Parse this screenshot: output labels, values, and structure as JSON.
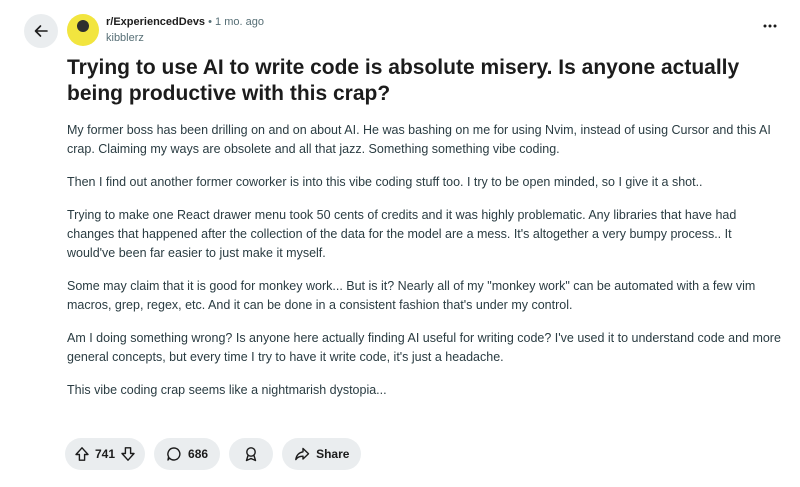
{
  "post": {
    "subreddit": "r/ExperiencedDevs",
    "separator": "•",
    "time": "1 mo. ago",
    "author": "kibblerz",
    "title": "Trying to use AI to write code is absolute misery. Is anyone actually being productive with this crap?",
    "paragraphs": [
      "My former boss has been drilling on and on about AI. He was bashing on me for using Nvim, instead of using Cursor and this AI crap. Claiming my ways are obsolete and all that jazz. Something something vibe coding.",
      "Then I find out another former coworker is into this vibe coding stuff too. I try to be open minded, so I give it a shot..",
      "Trying to make one React drawer menu took 50 cents of credits and it was highly problematic. Any libraries that have had changes that happened after the collection of the data for the model are a mess. It's altogether a very bumpy process.. It would've been far easier to just make it myself.",
      "Some may claim that it is good for monkey work... But is it? Nearly all of my \"monkey work\" can be automated with a few vim macros, grep, regex, etc. And it can be done in a consistent fashion that's under my control.",
      "Am I doing something wrong? Is anyone here actually finding AI useful for writing code? I've used it to understand code and more general concepts, but every time I try to have it write code, it's just a headache.",
      "This vibe coding crap seems like a nightmarish dystopia..."
    ]
  },
  "actions": {
    "upvotes": "741",
    "comments": "686",
    "share_label": "Share"
  },
  "icons": {
    "back": "arrow-left-icon",
    "more": "more-horizontal-icon",
    "upvote": "upvote-arrow-icon",
    "downvote": "downvote-arrow-icon",
    "comment": "comment-bubble-icon",
    "award": "award-icon",
    "share": "share-arrow-icon"
  },
  "colors": {
    "pill_bg": "#eaedef",
    "avatar": "#f2e53f",
    "meta_text": "#576f76",
    "body_text": "#2a3c42"
  }
}
